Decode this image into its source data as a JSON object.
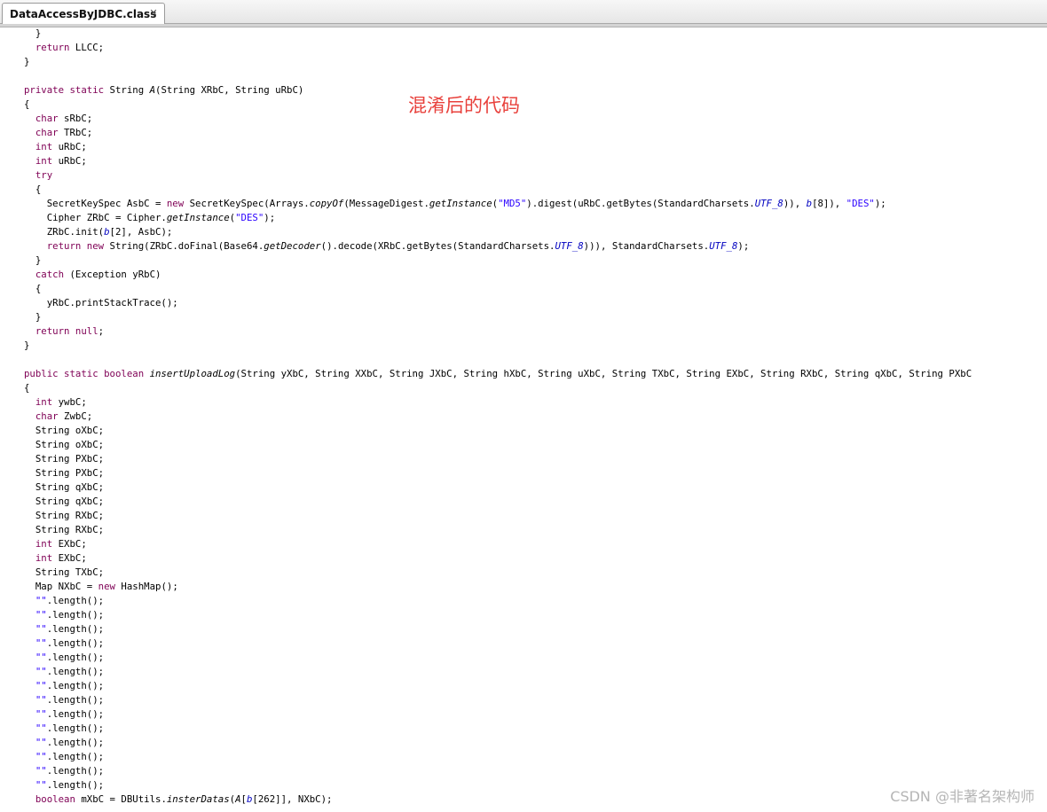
{
  "tab": {
    "title": "DataAccessByJDBC.class",
    "close_symbol": "✕"
  },
  "annotation": "混淆后的代码",
  "watermark": "CSDN @非著名架构师",
  "code_lines": [
    [
      {
        "t": "  }"
      }
    ],
    [
      {
        "t": "  "
      },
      {
        "t": "return",
        "c": "kw"
      },
      {
        "t": " LLCC;"
      }
    ],
    [
      {
        "t": "}"
      }
    ],
    [],
    [
      {
        "t": "private static",
        "c": "kw"
      },
      {
        "t": " String "
      },
      {
        "t": "A",
        "c": "it"
      },
      {
        "t": "(String XRbC, String uRbC)"
      }
    ],
    [
      {
        "t": "{"
      }
    ],
    [
      {
        "t": "  "
      },
      {
        "t": "char",
        "c": "kw"
      },
      {
        "t": " sRbC;"
      }
    ],
    [
      {
        "t": "  "
      },
      {
        "t": "char",
        "c": "kw"
      },
      {
        "t": " TRbC;"
      }
    ],
    [
      {
        "t": "  "
      },
      {
        "t": "int",
        "c": "kw"
      },
      {
        "t": " uRbC;"
      }
    ],
    [
      {
        "t": "  "
      },
      {
        "t": "int",
        "c": "kw"
      },
      {
        "t": " uRbC;"
      }
    ],
    [
      {
        "t": "  "
      },
      {
        "t": "try",
        "c": "kw"
      }
    ],
    [
      {
        "t": "  {"
      }
    ],
    [
      {
        "t": "    SecretKeySpec AsbC = "
      },
      {
        "t": "new",
        "c": "kw"
      },
      {
        "t": " SecretKeySpec(Arrays."
      },
      {
        "t": "copyOf",
        "c": "it"
      },
      {
        "t": "(MessageDigest."
      },
      {
        "t": "getInstance",
        "c": "it"
      },
      {
        "t": "("
      },
      {
        "t": "\"MD5\"",
        "c": "str"
      },
      {
        "t": ").digest(uRbC.getBytes(StandardCharsets."
      },
      {
        "t": "UTF_8",
        "c": "st"
      },
      {
        "t": ")), "
      },
      {
        "t": "b",
        "c": "st"
      },
      {
        "t": "[8]), "
      },
      {
        "t": "\"DES\"",
        "c": "str"
      },
      {
        "t": ");"
      }
    ],
    [
      {
        "t": "    Cipher ZRbC = Cipher."
      },
      {
        "t": "getInstance",
        "c": "it"
      },
      {
        "t": "("
      },
      {
        "t": "\"DES\"",
        "c": "str"
      },
      {
        "t": ");"
      }
    ],
    [
      {
        "t": "    ZRbC.init("
      },
      {
        "t": "b",
        "c": "st"
      },
      {
        "t": "[2], AsbC);"
      }
    ],
    [
      {
        "t": "    "
      },
      {
        "t": "return new",
        "c": "kw"
      },
      {
        "t": " String(ZRbC.doFinal(Base64."
      },
      {
        "t": "getDecoder",
        "c": "it"
      },
      {
        "t": "().decode(XRbC.getBytes(StandardCharsets."
      },
      {
        "t": "UTF_8",
        "c": "st"
      },
      {
        "t": "))), StandardCharsets."
      },
      {
        "t": "UTF_8",
        "c": "st"
      },
      {
        "t": ");"
      }
    ],
    [
      {
        "t": "  }"
      }
    ],
    [
      {
        "t": "  "
      },
      {
        "t": "catch",
        "c": "kw"
      },
      {
        "t": " (Exception yRbC)"
      }
    ],
    [
      {
        "t": "  {"
      }
    ],
    [
      {
        "t": "    yRbC.printStackTrace();"
      }
    ],
    [
      {
        "t": "  }"
      }
    ],
    [
      {
        "t": "  "
      },
      {
        "t": "return null",
        "c": "kw"
      },
      {
        "t": ";"
      }
    ],
    [
      {
        "t": "}"
      }
    ],
    [],
    [
      {
        "t": "public static boolean",
        "c": "kw"
      },
      {
        "t": " "
      },
      {
        "t": "insertUploadLog",
        "c": "it"
      },
      {
        "t": "(String yXbC, String XXbC, String JXbC, String hXbC, String uXbC, String TXbC, String EXbC, String RXbC, String qXbC, String PXbC"
      }
    ],
    [
      {
        "t": "{"
      }
    ],
    [
      {
        "t": "  "
      },
      {
        "t": "int",
        "c": "kw"
      },
      {
        "t": " ywbC;"
      }
    ],
    [
      {
        "t": "  "
      },
      {
        "t": "char",
        "c": "kw"
      },
      {
        "t": " ZwbC;"
      }
    ],
    [
      {
        "t": "  String oXbC;"
      }
    ],
    [
      {
        "t": "  String oXbC;"
      }
    ],
    [
      {
        "t": "  String PXbC;"
      }
    ],
    [
      {
        "t": "  String PXbC;"
      }
    ],
    [
      {
        "t": "  String qXbC;"
      }
    ],
    [
      {
        "t": "  String qXbC;"
      }
    ],
    [
      {
        "t": "  String RXbC;"
      }
    ],
    [
      {
        "t": "  String RXbC;"
      }
    ],
    [
      {
        "t": "  "
      },
      {
        "t": "int",
        "c": "kw"
      },
      {
        "t": " EXbC;"
      }
    ],
    [
      {
        "t": "  "
      },
      {
        "t": "int",
        "c": "kw"
      },
      {
        "t": " EXbC;"
      }
    ],
    [
      {
        "t": "  String TXbC;"
      }
    ],
    [
      {
        "t": "  Map NXbC = "
      },
      {
        "t": "new",
        "c": "kw"
      },
      {
        "t": " HashMap();"
      }
    ],
    [
      {
        "t": "  "
      },
      {
        "t": "\"\"",
        "c": "str"
      },
      {
        "t": ".length();"
      }
    ],
    [
      {
        "t": "  "
      },
      {
        "t": "\"\"",
        "c": "str"
      },
      {
        "t": ".length();"
      }
    ],
    [
      {
        "t": "  "
      },
      {
        "t": "\"\"",
        "c": "str"
      },
      {
        "t": ".length();"
      }
    ],
    [
      {
        "t": "  "
      },
      {
        "t": "\"\"",
        "c": "str"
      },
      {
        "t": ".length();"
      }
    ],
    [
      {
        "t": "  "
      },
      {
        "t": "\"\"",
        "c": "str"
      },
      {
        "t": ".length();"
      }
    ],
    [
      {
        "t": "  "
      },
      {
        "t": "\"\"",
        "c": "str"
      },
      {
        "t": ".length();"
      }
    ],
    [
      {
        "t": "  "
      },
      {
        "t": "\"\"",
        "c": "str"
      },
      {
        "t": ".length();"
      }
    ],
    [
      {
        "t": "  "
      },
      {
        "t": "\"\"",
        "c": "str"
      },
      {
        "t": ".length();"
      }
    ],
    [
      {
        "t": "  "
      },
      {
        "t": "\"\"",
        "c": "str"
      },
      {
        "t": ".length();"
      }
    ],
    [
      {
        "t": "  "
      },
      {
        "t": "\"\"",
        "c": "str"
      },
      {
        "t": ".length();"
      }
    ],
    [
      {
        "t": "  "
      },
      {
        "t": "\"\"",
        "c": "str"
      },
      {
        "t": ".length();"
      }
    ],
    [
      {
        "t": "  "
      },
      {
        "t": "\"\"",
        "c": "str"
      },
      {
        "t": ".length();"
      }
    ],
    [
      {
        "t": "  "
      },
      {
        "t": "\"\"",
        "c": "str"
      },
      {
        "t": ".length();"
      }
    ],
    [
      {
        "t": "  "
      },
      {
        "t": "\"\"",
        "c": "str"
      },
      {
        "t": ".length();"
      }
    ],
    [
      {
        "t": "  "
      },
      {
        "t": "boolean",
        "c": "kw"
      },
      {
        "t": " mXbC = DBUtils."
      },
      {
        "t": "insterDatas",
        "c": "it"
      },
      {
        "t": "("
      },
      {
        "t": "A",
        "c": "it"
      },
      {
        "t": "["
      },
      {
        "t": "b",
        "c": "st"
      },
      {
        "t": "[262]], NXbC);"
      }
    ]
  ],
  "colors": {
    "keyword": "#7f0055",
    "string": "#2a00ff",
    "static_field": "#0000c0",
    "annotation": "#e8413c",
    "watermark": "#b5b5b5"
  }
}
